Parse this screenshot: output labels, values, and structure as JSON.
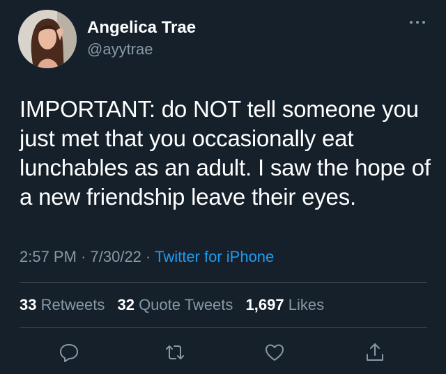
{
  "author": {
    "name": "Angelica Trae",
    "handle": "@ayytrae"
  },
  "tweet": {
    "text": "IMPORTANT: do NOT tell someone you just met that you occasionally eat lunchables as an adult. I saw the hope of a new friendship leave their eyes.",
    "time": "2:57 PM",
    "date": "7/30/22",
    "source": "Twitter for iPhone"
  },
  "stats": {
    "retweets_count": "33",
    "retweets_label": "Retweets",
    "quotes_count": "32",
    "quotes_label": "Quote Tweets",
    "likes_count": "1,697",
    "likes_label": "Likes"
  },
  "icons": [
    "more-icon",
    "reply-icon",
    "retweet-icon",
    "like-icon",
    "share-icon"
  ],
  "colors": {
    "background": "#15202b",
    "accent": "#1d9bf0",
    "muted": "#8899a6"
  }
}
